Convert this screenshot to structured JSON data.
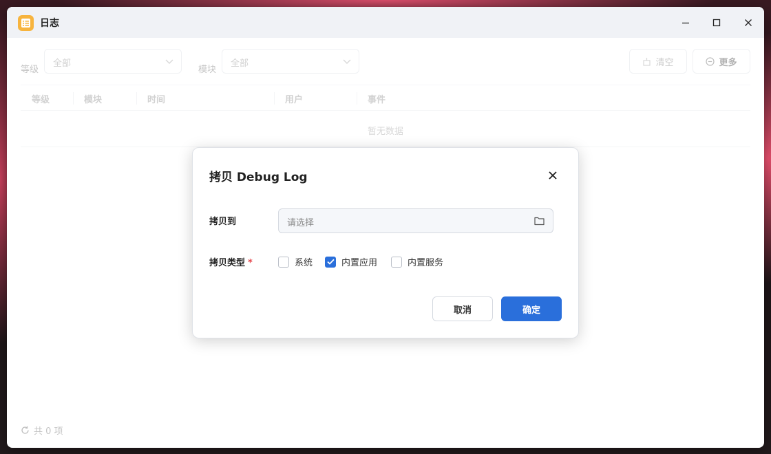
{
  "window": {
    "title": "日志"
  },
  "filters": {
    "level_label": "等级",
    "level_value": "全部",
    "module_label": "模块",
    "module_value": "全部",
    "clear_label": "清空",
    "more_label": "更多"
  },
  "table": {
    "columns": [
      "等级",
      "模块",
      "时间",
      "用户",
      "事件"
    ],
    "empty_text": "暂无数据"
  },
  "footer": {
    "count_text": "共 0 项"
  },
  "dialog": {
    "title": "拷贝 Debug Log",
    "copy_to_label": "拷贝到",
    "copy_to_placeholder": "请选择",
    "copy_type_label": "拷贝类型",
    "required_mark": "*",
    "options": [
      {
        "label": "系统",
        "checked": false
      },
      {
        "label": "内置应用",
        "checked": true
      },
      {
        "label": "内置服务",
        "checked": false
      }
    ],
    "cancel_label": "取消",
    "ok_label": "确定"
  },
  "colors": {
    "primary": "#2a6fdb",
    "app_icon": "#f7b43e",
    "titlebar": "#f0f2f6",
    "required": "#e5484d"
  }
}
